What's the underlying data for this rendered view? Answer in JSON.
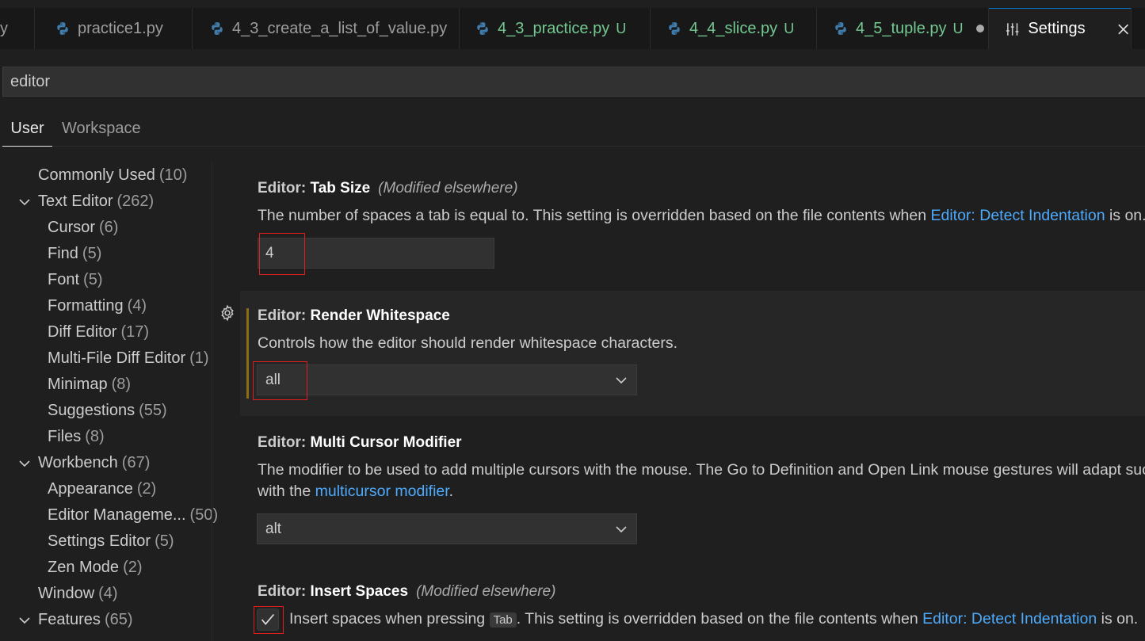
{
  "tabs": [
    {
      "label": "y"
    },
    {
      "label": "practice1.py",
      "icon": "python-icon"
    },
    {
      "label": "4_3_create_a_list_of_value.py",
      "icon": "python-icon"
    },
    {
      "label": "4_3_practice.py",
      "icon": "python-icon",
      "badge": "U"
    },
    {
      "label": "4_4_slice.py",
      "icon": "python-icon",
      "badge": "U"
    },
    {
      "label": "4_5_tuple.py",
      "icon": "python-icon",
      "badge": "U",
      "dirty": true
    },
    {
      "label": "Settings",
      "icon": "settings-sliders-icon",
      "active": true
    }
  ],
  "search": {
    "value": "editor"
  },
  "scope_tabs": {
    "user": "User",
    "workspace": "Workspace"
  },
  "toc": [
    {
      "label": "Commonly Used",
      "count": "(10)"
    },
    {
      "label": "Text Editor",
      "count": "(262)",
      "expanded": true
    },
    {
      "label": "Cursor",
      "count": "(6)"
    },
    {
      "label": "Find",
      "count": "(5)"
    },
    {
      "label": "Font",
      "count": "(5)"
    },
    {
      "label": "Formatting",
      "count": "(4)"
    },
    {
      "label": "Diff Editor",
      "count": "(17)"
    },
    {
      "label": "Multi-File Diff Editor",
      "count": "(1)"
    },
    {
      "label": "Minimap",
      "count": "(8)"
    },
    {
      "label": "Suggestions",
      "count": "(55)"
    },
    {
      "label": "Files",
      "count": "(8)"
    },
    {
      "label": "Workbench",
      "count": "(67)",
      "expanded": true
    },
    {
      "label": "Appearance",
      "count": "(2)"
    },
    {
      "label": "Editor Manageme...",
      "count": "(50)"
    },
    {
      "label": "Settings Editor",
      "count": "(5)"
    },
    {
      "label": "Zen Mode",
      "count": "(2)"
    },
    {
      "label": "Window",
      "count": "(4)"
    },
    {
      "label": "Features",
      "count": "(65)",
      "expanded": true
    }
  ],
  "settings": {
    "tab_size": {
      "category": "Editor: ",
      "name": "Tab Size",
      "modified": "(Modified elsewhere)",
      "desc_before": "The number of spaces a tab is equal to. This setting is overridden based on the file contents when ",
      "desc_link": "Editor: Detect Indentation",
      "desc_after": " is on.",
      "value": "4"
    },
    "render_whitespace": {
      "category": "Editor: ",
      "name": "Render Whitespace",
      "desc": "Controls how the editor should render whitespace characters.",
      "value": "all"
    },
    "multi_cursor": {
      "category": "Editor: ",
      "name": "Multi Cursor Modifier",
      "desc_line1": "The modifier to be used to add multiple cursors with the mouse. The Go to Definition and Open Link mouse gestures will adapt such",
      "desc_line2_before": "with the ",
      "desc_line2_link": "multicursor modifier",
      "desc_line2_after": ".",
      "value": "alt"
    },
    "insert_spaces": {
      "category": "Editor: ",
      "name": "Insert Spaces",
      "modified": "(Modified elsewhere)",
      "desc_before": "Insert spaces when pressing ",
      "desc_kbd": "Tab",
      "desc_mid": ". This setting is overridden based on the file contents when ",
      "desc_link": "Editor: Detect Indentation",
      "desc_after": " is on.",
      "checked": true
    }
  },
  "colors": {
    "background": "#1f1f1f",
    "link": "#4daafc",
    "untracked": "#73c991",
    "highlight_box": "#e02020",
    "modified_bar": "#8a6d14"
  }
}
